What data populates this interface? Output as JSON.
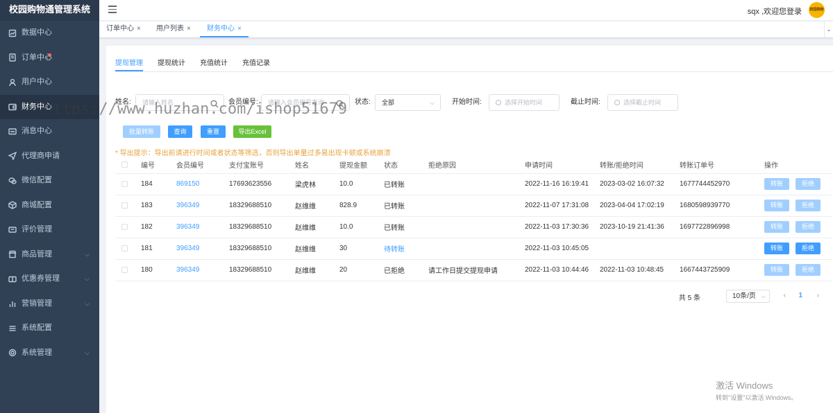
{
  "app": {
    "title": "校园购物通管理系统"
  },
  "sidebar": {
    "items": [
      {
        "label": "数据中心",
        "icon": "chart-icon"
      },
      {
        "label": "订单中心",
        "icon": "document-icon",
        "badge_dot": true
      },
      {
        "label": "用户中心",
        "icon": "user-icon"
      },
      {
        "label": "财务中心",
        "icon": "wallet-icon",
        "active": true
      },
      {
        "label": "消息中心",
        "icon": "message-icon"
      },
      {
        "label": "代理商申请",
        "icon": "send-icon"
      },
      {
        "label": "微信配置",
        "icon": "wechat-icon"
      },
      {
        "label": "商城配置",
        "icon": "cube-icon"
      },
      {
        "label": "评价管理",
        "icon": "comment-icon"
      },
      {
        "label": "商品管理",
        "icon": "store-icon",
        "expandable": true
      },
      {
        "label": "优惠券管理",
        "icon": "coupon-icon",
        "expandable": true
      },
      {
        "label": "营销管理",
        "icon": "bar-chart-icon",
        "expandable": true
      },
      {
        "label": "系统配置",
        "icon": "list-icon"
      },
      {
        "label": "系统管理",
        "icon": "gear-icon",
        "expandable": true
      }
    ]
  },
  "header": {
    "greeting": "sqx ,欢迎您登录",
    "avatar_text": "校园购物通"
  },
  "tabs": [
    {
      "label": "订单中心",
      "close": "×"
    },
    {
      "label": "用户列表",
      "close": "×"
    },
    {
      "label": "财务中心",
      "close": "×",
      "active": true
    }
  ],
  "subtabs": [
    {
      "label": "提现管理",
      "active": true
    },
    {
      "label": "提现统计"
    },
    {
      "label": "充值统计"
    },
    {
      "label": "充值记录"
    }
  ],
  "filters": {
    "name_label": "姓名:",
    "name_placeholder": "请输入姓名",
    "member_label": "会员编号:",
    "member_placeholder": "请输入会员编号查询",
    "status_label": "状态:",
    "status_value": "全部",
    "start_label": "开始时间:",
    "start_placeholder": "选择开始时间",
    "end_label": "截止时间:",
    "end_placeholder": "选择截止时间"
  },
  "buttons": {
    "batch": "批量转账",
    "query": "查询",
    "reset": "重置",
    "export": "导出Excel"
  },
  "notice": "* 导出提示：导出前请进行时间或者状态等筛选，否则导出单量过多易出现卡顿或系统崩溃",
  "table": {
    "headers": [
      "编号",
      "会员编号",
      "支付宝账号",
      "姓名",
      "提现金额",
      "状态",
      "拒绝原因",
      "申请时间",
      "转账/拒绝时间",
      "转账订单号",
      "操作"
    ],
    "rows": [
      {
        "id": "184",
        "member": "869150",
        "alipay": "17693623556",
        "name": "梁虎林",
        "amount": "10.0",
        "status": "已转账",
        "reason": "",
        "apply_time": "2022-11-16 16:19:41",
        "done_time": "2023-03-02 16:07:32",
        "order_no": "1677744452970",
        "enabled": false
      },
      {
        "id": "183",
        "member": "396349",
        "alipay": "18329688510",
        "name": "赵维维",
        "amount": "828.9",
        "status": "已转账",
        "reason": "",
        "apply_time": "2022-11-07 17:31:08",
        "done_time": "2023-04-04 17:02:19",
        "order_no": "1680598939770",
        "enabled": false
      },
      {
        "id": "182",
        "member": "396349",
        "alipay": "18329688510",
        "name": "赵维维",
        "amount": "10.0",
        "status": "已转账",
        "reason": "",
        "apply_time": "2022-11-03 17:30:36",
        "done_time": "2023-10-19 21:41:36",
        "order_no": "1697722896998",
        "enabled": false
      },
      {
        "id": "181",
        "member": "396349",
        "alipay": "18329688510",
        "name": "赵维维",
        "amount": "30",
        "status": "待转账",
        "reason": "",
        "apply_time": "2022-11-03 10:45:05",
        "done_time": "",
        "order_no": "",
        "enabled": true
      },
      {
        "id": "180",
        "member": "396349",
        "alipay": "18329688510",
        "name": "赵维维",
        "amount": "20",
        "status": "已拒绝",
        "reason": "请工作日提交提现申请",
        "apply_time": "2022-11-03 10:44:46",
        "done_time": "2022-11-03 10:48:45",
        "order_no": "1667443725909",
        "enabled": false
      }
    ],
    "transfer_label": "转账",
    "reject_label": "拒绝"
  },
  "pager": {
    "total": "共 5 条",
    "page_size": "10条/页",
    "current": "1",
    "prev": "‹",
    "next": "›"
  },
  "watermark": "https://www.huzhan.com/ishop51679",
  "activation": {
    "line1": "激活 Windows",
    "line2": "转到\"设置\"以激活 Windows。"
  },
  "colors": {
    "primary": "#409eff",
    "sidebar": "#304156",
    "success": "#67c23a",
    "warning": "#e6a23c"
  }
}
